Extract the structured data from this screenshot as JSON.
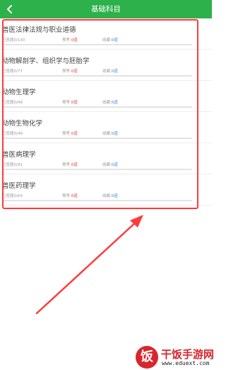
{
  "header": {
    "title": "基础科目",
    "back_icon": "back-arrow-icon"
  },
  "labels": {
    "progress_prefix": "已答题",
    "exam_label": "预考:",
    "exam_value": "0道",
    "fav_label": "收藏:",
    "fav_value": "0道"
  },
  "subjects": [
    {
      "title": "兽医法律法规与职业道德",
      "progress": "0/130",
      "fraction": 0
    },
    {
      "title": "动物解剖学、组织学与胚胎学",
      "progress": "0/77",
      "fraction": 0
    },
    {
      "title": "动物生理学",
      "progress": "0/49",
      "fraction": 0
    },
    {
      "title": "动物生物化学",
      "progress": "0/49",
      "fraction": 0
    },
    {
      "title": "兽医病理学",
      "progress": "0/91",
      "fraction": 0
    },
    {
      "title": "兽医药理学",
      "progress": "0/69",
      "fraction": 0
    }
  ],
  "colors": {
    "accent": "#2db14a",
    "highlight": "#ff3b3b",
    "danger": "#e53935",
    "info": "#3b7de0"
  },
  "watermark": {
    "logo_char": "饭",
    "name": "干饭手游网",
    "url": "www.eduext.com"
  }
}
